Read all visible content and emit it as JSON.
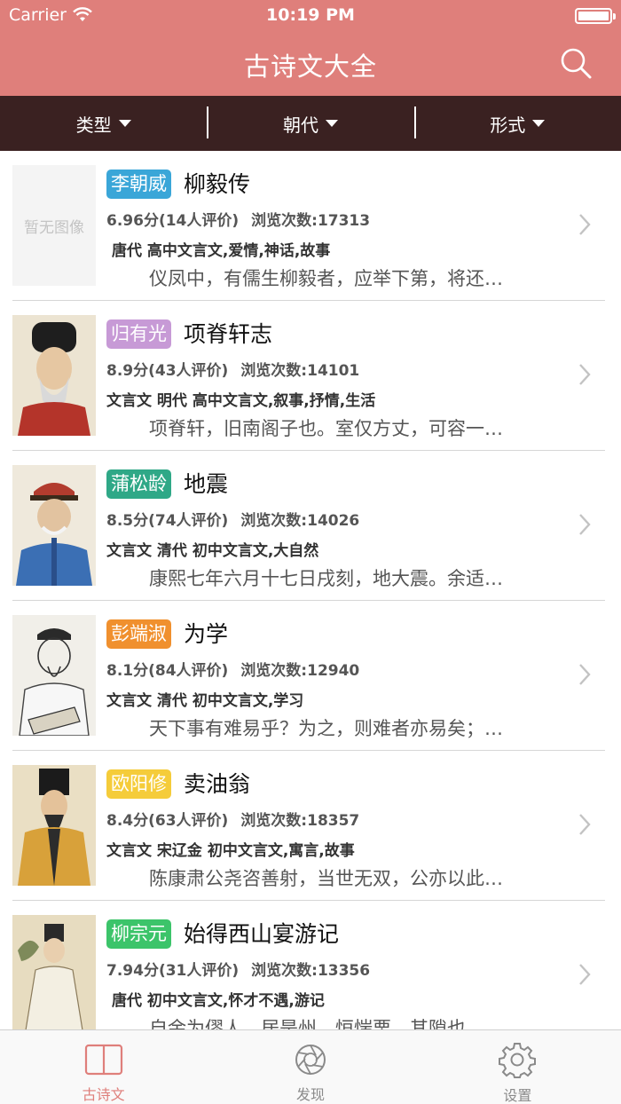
{
  "status": {
    "carrier": "Carrier",
    "time": "10:19 PM"
  },
  "nav": {
    "title": "古诗文大全"
  },
  "filters": [
    {
      "label": "类型"
    },
    {
      "label": "朝代"
    },
    {
      "label": "形式"
    }
  ],
  "items": [
    {
      "author": "李朝威",
      "author_color": "#3aa6d8",
      "title": "柳毅传",
      "rating": "6.96分(14人评价)",
      "views": "浏览次数:17313",
      "tags": "唐代 高中文言文,爱情,神话,故事",
      "excerpt": "仪凤中，有儒生柳毅者，应举下第，将还…",
      "thumb_text": "暂无图像"
    },
    {
      "author": "归有光",
      "author_color": "#c79ad6",
      "title": "项脊轩志",
      "rating": "8.9分(43人评价)",
      "views": "浏览次数:14101",
      "tags": "文言文 明代 高中文言文,叙事,抒情,生活",
      "excerpt": "项脊轩，旧南阁子也。室仅方丈，可容一…"
    },
    {
      "author": "蒲松龄",
      "author_color": "#2fa887",
      "title": "地震",
      "rating": "8.5分(74人评价)",
      "views": "浏览次数:14026",
      "tags": "文言文 清代 初中文言文,大自然",
      "excerpt": "康熙七年六月十七日戌刻，地大震。余适…"
    },
    {
      "author": "彭端淑",
      "author_color": "#f0902e",
      "title": "为学",
      "rating": "8.1分(84人评价)",
      "views": "浏览次数:12940",
      "tags": "文言文 清代 初中文言文,学习",
      "excerpt": "天下事有难易乎？为之，则难者亦易矣；…"
    },
    {
      "author": "欧阳修",
      "author_color": "#f5cc3a",
      "title": "卖油翁",
      "rating": "8.4分(63人评价)",
      "views": "浏览次数:18357",
      "tags": "文言文 宋辽金 初中文言文,寓言,故事",
      "excerpt": "陈康肃公尧咨善射，当世无双，公亦以此…"
    },
    {
      "author": "柳宗元",
      "author_color": "#3cc46a",
      "title": "始得西山宴游记",
      "rating": "7.94分(31人评价)",
      "views": "浏览次数:13356",
      "tags": "唐代 初中文言文,怀才不遇,游记",
      "excerpt": "自余为僇人，居是州，恒惴栗。其隙也…"
    }
  ],
  "tabs": [
    {
      "label": "古诗文",
      "icon": "book-icon"
    },
    {
      "label": "发现",
      "icon": "aperture-icon"
    },
    {
      "label": "设置",
      "icon": "gear-icon"
    }
  ],
  "colors": {
    "accent": "#df7f7b",
    "filterbar": "#3a2121"
  }
}
